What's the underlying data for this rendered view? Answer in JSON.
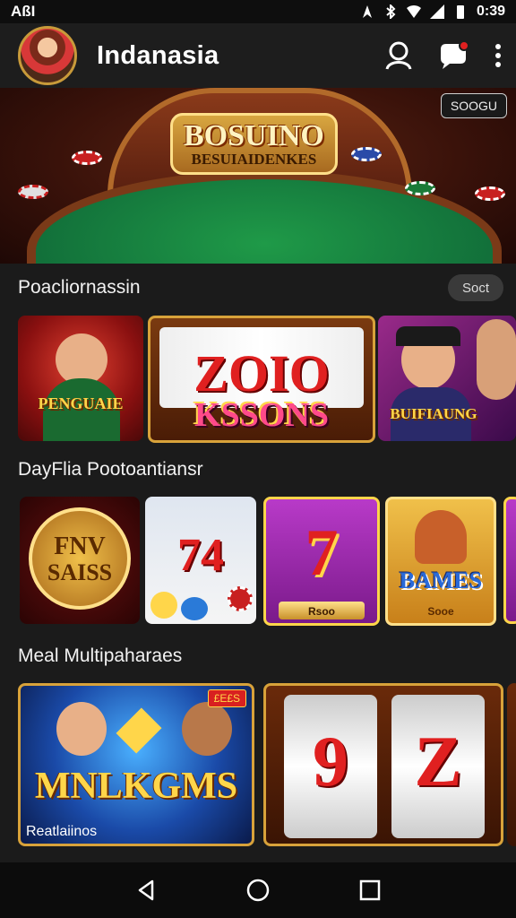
{
  "status_bar": {
    "carrier": "AßI",
    "time": "0:39"
  },
  "app_bar": {
    "title": "Indanasia"
  },
  "hero": {
    "logo_line1": "BOSUINO",
    "logo_line2": "BESUIAIDENKES",
    "badge": "SOOGU"
  },
  "sections": {
    "s1": {
      "title": "Poacliornassin",
      "action": "Soct",
      "tiles": [
        "PENGUAIE",
        "ZOIO",
        "KSSONS",
        "BUIFIAUNG"
      ]
    },
    "s2": {
      "title": "DayFlia Pootoantiansr",
      "tiles": [
        "FNV",
        "SAISS",
        "74",
        "7",
        "Rsoo",
        "BAMES",
        "Sooe"
      ]
    },
    "s3": {
      "title": "Meal Multipaharaes",
      "tiles": [
        "MNLKGMS",
        "Reatlaiinos",
        "9",
        "Z"
      ],
      "tag": "£E£S"
    }
  },
  "colors": {
    "background": "#1b1b1b",
    "appbar": "#1d1d1d",
    "accent_gold": "#ffd64a",
    "accent_red": "#d82020"
  }
}
